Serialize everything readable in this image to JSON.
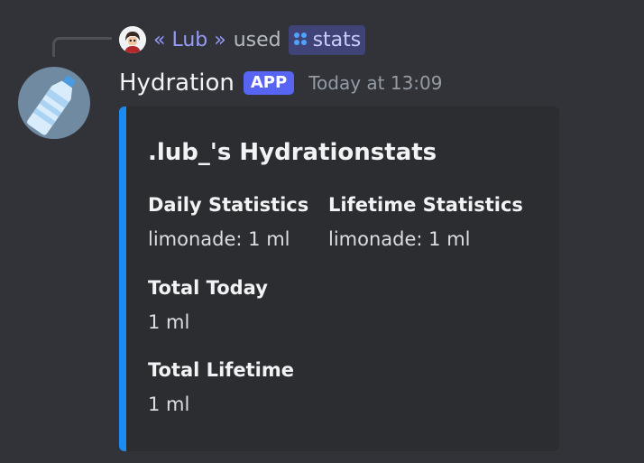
{
  "reply": {
    "user": "« Lub »",
    "used_text": "used",
    "command": "stats"
  },
  "message": {
    "author": "Hydration",
    "badge": "APP",
    "timestamp": "Today at 13:09"
  },
  "embed": {
    "title": ".lub_'s Hydrationstats",
    "accent_color": "#1a8bf2",
    "fields": {
      "daily": {
        "name": "Daily Statistics",
        "value": "limonade: 1 ml"
      },
      "lifetime": {
        "name": "Lifetime Statistics",
        "value": "limonade: 1 ml"
      },
      "total_today": {
        "name": "Total Today",
        "value": "1 ml"
      },
      "total_lifetime": {
        "name": "Total Lifetime",
        "value": "1 ml"
      }
    }
  },
  "icons": {
    "reply_avatar": "user-avatar-icon",
    "command": "slash-command-icon",
    "bot_avatar": "water-bottle-icon"
  }
}
